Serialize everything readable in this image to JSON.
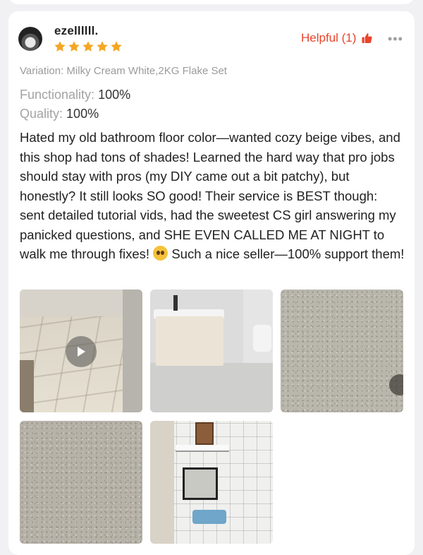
{
  "review": {
    "username": "ezellllll.",
    "rating": 5,
    "helpful_label": "Helpful (1)",
    "more_label": "•••",
    "variation": "Variation: Milky Cream White,2KG Flake Set",
    "attributes": [
      {
        "key": "Functionality:",
        "value": "100%"
      },
      {
        "key": "Quality:",
        "value": "100%"
      }
    ],
    "text_before_emoji": "Hated my old bathroom floor color—wanted cozy beige vibes, and this shop had tons of shades! Learned the hard way that pro jobs should stay with pros (my DIY came out a bit patchy), but honestly? It still looks SO good! Their service is BEST though: sent detailed tutorial vids, had the sweetest CS girl answering my panicked questions, and SHE EVEN CALLED ME AT NIGHT to walk me through fixes!",
    "text_after_emoji": " Such a nice seller—100% support them!"
  },
  "colors": {
    "accent": "#e8452c",
    "star": "#f5a623",
    "text": "#222222",
    "muted": "#9b9b9b"
  },
  "media": [
    {
      "kind": "video",
      "icon": "play-icon"
    },
    {
      "kind": "image"
    },
    {
      "kind": "image"
    },
    {
      "kind": "image"
    },
    {
      "kind": "image"
    }
  ]
}
